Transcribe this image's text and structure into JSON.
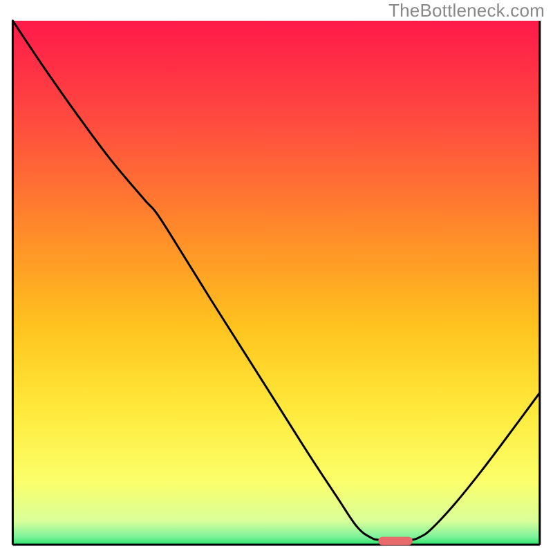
{
  "watermark": "TheBottleneck.com",
  "chart_data": {
    "type": "line",
    "title": "",
    "xlabel": "",
    "ylabel": "",
    "xlim": [
      0,
      100
    ],
    "ylim": [
      0,
      100
    ],
    "gradient_stops": [
      {
        "offset": 0.0,
        "color": "#ff1a4a"
      },
      {
        "offset": 0.2,
        "color": "#ff4d3f"
      },
      {
        "offset": 0.4,
        "color": "#ff8a2a"
      },
      {
        "offset": 0.58,
        "color": "#ffc21e"
      },
      {
        "offset": 0.74,
        "color": "#ffe93a"
      },
      {
        "offset": 0.88,
        "color": "#fbff6a"
      },
      {
        "offset": 0.955,
        "color": "#d9ff9a"
      },
      {
        "offset": 0.985,
        "color": "#7ef29a"
      },
      {
        "offset": 1.0,
        "color": "#2ae56a"
      }
    ],
    "curve_points": [
      {
        "x": 2.3,
        "y": 100.0
      },
      {
        "x": 8.0,
        "y": 91.0
      },
      {
        "x": 14.0,
        "y": 82.0
      },
      {
        "x": 20.0,
        "y": 73.5
      },
      {
        "x": 26.0,
        "y": 66.0
      },
      {
        "x": 28.5,
        "y": 63.0
      },
      {
        "x": 33.0,
        "y": 55.5
      },
      {
        "x": 38.0,
        "y": 47.0
      },
      {
        "x": 44.0,
        "y": 37.0
      },
      {
        "x": 50.0,
        "y": 27.0
      },
      {
        "x": 56.0,
        "y": 17.0
      },
      {
        "x": 61.0,
        "y": 9.0
      },
      {
        "x": 64.5,
        "y": 3.5
      },
      {
        "x": 67.0,
        "y": 1.4
      },
      {
        "x": 69.0,
        "y": 0.9
      },
      {
        "x": 74.0,
        "y": 0.9
      },
      {
        "x": 76.0,
        "y": 1.5
      },
      {
        "x": 78.0,
        "y": 3.0
      },
      {
        "x": 82.0,
        "y": 7.5
      },
      {
        "x": 87.0,
        "y": 14.0
      },
      {
        "x": 92.0,
        "y": 21.0
      },
      {
        "x": 97.6,
        "y": 29.0
      }
    ],
    "marker": {
      "x": 71.5,
      "y": 0.7,
      "width": 6.2,
      "height": 1.6,
      "radius": 0.8,
      "color": "#e86a6a"
    },
    "axis": {
      "x0": 2.3,
      "x1": 97.6,
      "y0": 0.0,
      "stroke": "#000000",
      "width": 3
    },
    "curve_stroke": "#000000",
    "curve_width": 3
  }
}
